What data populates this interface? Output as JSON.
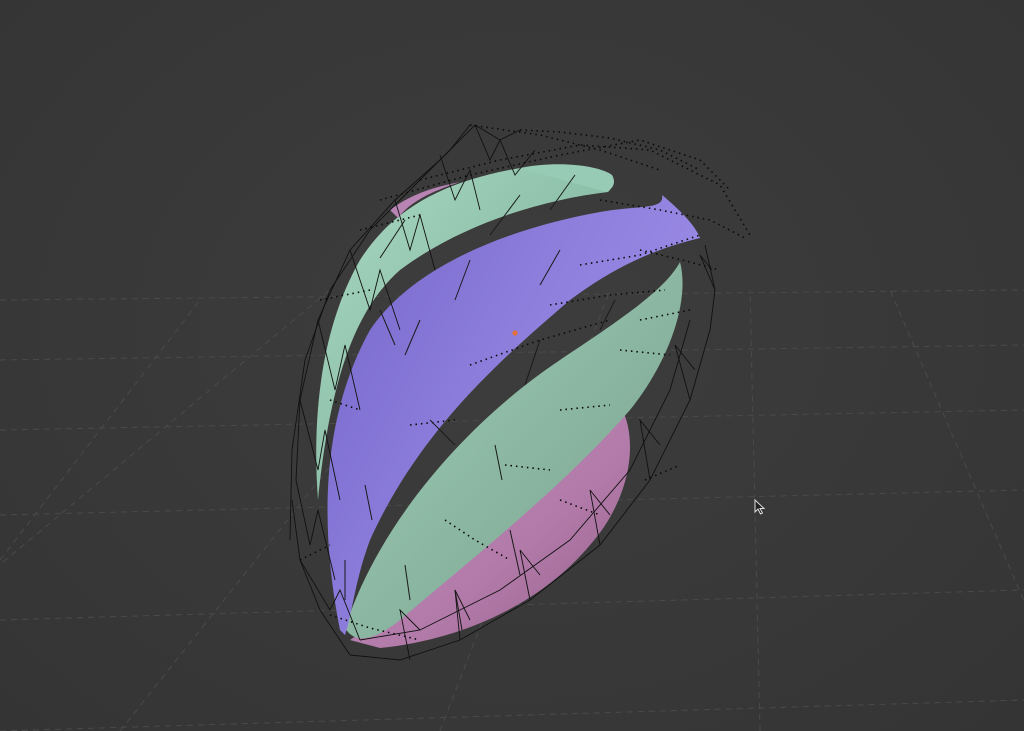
{
  "viewport": {
    "mode": "3D viewport",
    "background_color": "#393939",
    "grid_color": "#4a4a4a"
  },
  "object": {
    "shape": "petal bulb",
    "segments": [
      {
        "name": "green-segment",
        "color": "#8fc2ab"
      },
      {
        "name": "purple-segment",
        "color": "#8a7ad8"
      },
      {
        "name": "pink-segment",
        "color": "#b67fb0"
      }
    ],
    "wireframe_cage_color": "#111111",
    "origin_marker_color": "#e0703c"
  },
  "cursor": {
    "icon": "pointer-arrow-icon"
  }
}
